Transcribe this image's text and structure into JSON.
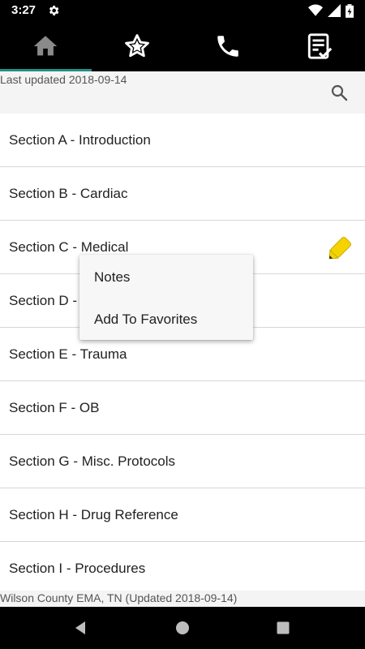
{
  "status_bar": {
    "time": "3:27"
  },
  "tabs": [
    {
      "name": "home",
      "icon": "home-icon",
      "active": true
    },
    {
      "name": "favorites",
      "icon": "star-icon",
      "active": false
    },
    {
      "name": "phone",
      "icon": "phone-icon",
      "active": false
    },
    {
      "name": "checklist",
      "icon": "checklist-icon",
      "active": false
    }
  ],
  "header": {
    "last_updated": "Last updated 2018-09-14"
  },
  "sections": [
    "Section A - Introduction",
    "Section B - Cardiac",
    "Section C - Medical",
    "Section D - ",
    "Section E - Trauma",
    "Section F - OB",
    "Section G - Misc. Protocols",
    "Section H - Drug Reference",
    "Section I - Procedures"
  ],
  "popup_menu": {
    "items": [
      "Notes",
      "Add To Favorites"
    ]
  },
  "footer": {
    "text": "Wilson County EMA, TN (Updated 2018-09-14)"
  },
  "colors": {
    "accent": "#1f8f86",
    "pencil": "#f5d300"
  }
}
